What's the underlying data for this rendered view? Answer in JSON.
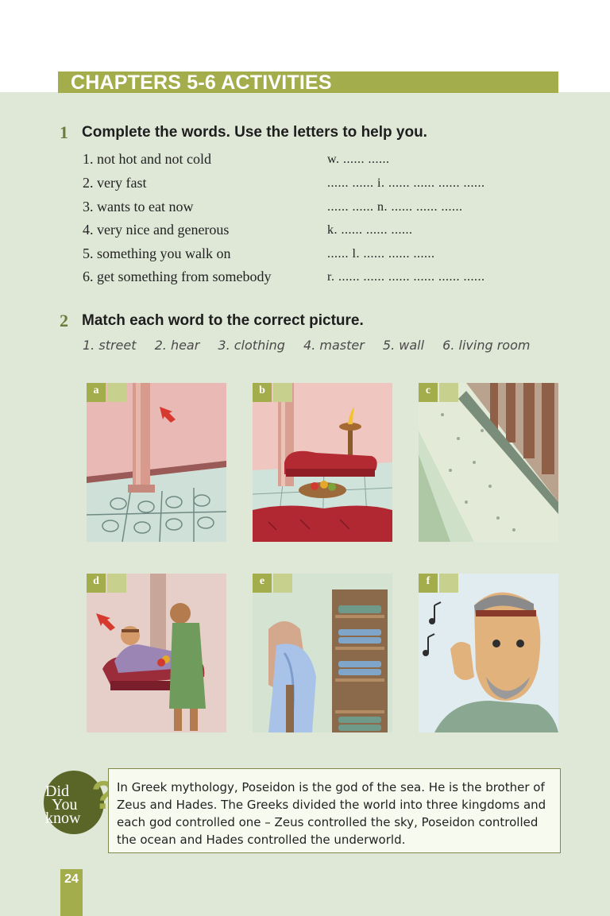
{
  "header": {
    "title": "CHAPTERS 5-6 ACTIVITIES"
  },
  "exercise1": {
    "number": "1",
    "instruction": "Complete the words. Use the letters to help you.",
    "items": [
      {
        "clue": "1. not hot and not cold",
        "answer": "w. ...... ......"
      },
      {
        "clue": "2. very fast",
        "answer": "...... ...... i. ...... ...... ...... ......"
      },
      {
        "clue": "3. wants to eat now",
        "answer": "...... ...... n. ...... ...... ......"
      },
      {
        "clue": "4. very nice and generous",
        "answer": "k. ...... ...... ......"
      },
      {
        "clue": "5. something you walk on",
        "answer": "...... l. ...... ...... ......"
      },
      {
        "clue": "6. get something from somebody",
        "answer": "r. ...... ...... ...... ...... ...... ......"
      }
    ]
  },
  "exercise2": {
    "number": "2",
    "instruction": "Match each word to the correct picture.",
    "words": [
      "1. street",
      "2. hear",
      "3. clothing",
      "4. master",
      "5. wall",
      "6. living room"
    ],
    "pictures": [
      {
        "letter": "a",
        "icon": "wall-with-arrow-illustration"
      },
      {
        "letter": "b",
        "icon": "living-room-couch-illustration"
      },
      {
        "letter": "c",
        "icon": "street-colonnade-illustration"
      },
      {
        "letter": "d",
        "icon": "master-reclining-illustration"
      },
      {
        "letter": "e",
        "icon": "clothing-shelves-illustration"
      },
      {
        "letter": "f",
        "icon": "man-hearing-illustration"
      }
    ]
  },
  "did_you_know": {
    "badge": [
      "Did",
      "You",
      "know"
    ],
    "text": "In Greek mythology, Poseidon is the god of the sea. He is the brother of Zeus and Hades. The Greeks divided the world into three kingdoms and each god controlled one – Zeus controlled the sky, Poseidon controlled the ocean and Hades controlled the underworld."
  },
  "page_number": "24",
  "colors": {
    "accent": "#a4ad4c",
    "background": "#dfe7d7",
    "number": "#6c7c3a"
  }
}
